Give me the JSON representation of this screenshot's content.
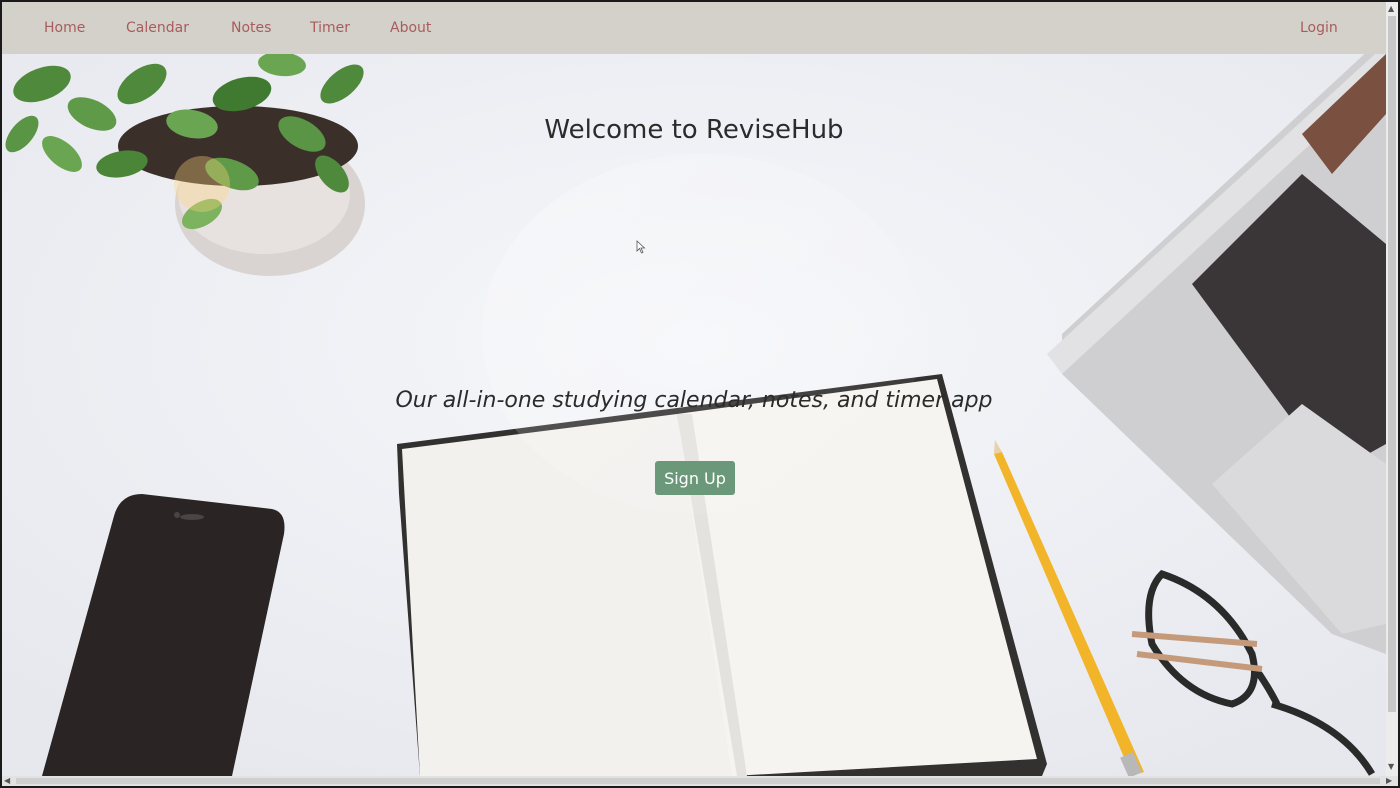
{
  "nav": {
    "items": [
      {
        "label": "Home"
      },
      {
        "label": "Calendar"
      },
      {
        "label": "Notes"
      },
      {
        "label": "Timer"
      },
      {
        "label": "About"
      }
    ],
    "login_label": "Login"
  },
  "hero": {
    "title": "Welcome to ReviseHub",
    "subtitle": "Our all-in-one studying calendar, notes, and timer app",
    "signup_label": "Sign Up"
  },
  "colors": {
    "nav_background": "#d4d1cb",
    "nav_link": "#a85c5c",
    "button": "#6a9878"
  }
}
